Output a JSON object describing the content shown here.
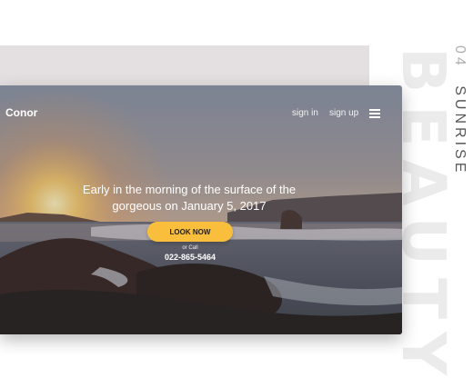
{
  "side": {
    "number": "04",
    "title": "SUNRISE",
    "ghost_word": "BEAUTY"
  },
  "header": {
    "brand": "Conor",
    "nav": [
      "sign in",
      "sign up"
    ],
    "menu_icon": "hamburger-menu-icon"
  },
  "hero": {
    "headline_line1": "Early in the morning of the surface of the",
    "headline_line2": "gorgeous on January 5, 2017",
    "cta_label": "LOOK NOW",
    "or_call": "or Call",
    "phone": "022-865-5464"
  },
  "colors": {
    "accent": "#f8be3c",
    "backdrop": "#e4dfe0",
    "ghost_text": "#ecebeb"
  }
}
